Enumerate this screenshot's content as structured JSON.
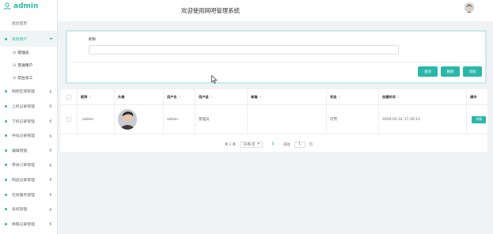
{
  "brand": {
    "name": "admin"
  },
  "header": {
    "title": "欢迎使用网吧管理系统"
  },
  "sidebar": {
    "home": "后台首页",
    "items": [
      {
        "label": "系统用户",
        "active": true,
        "children": [
          "管理员",
          "普通用户",
          "前台员工"
        ]
      },
      {
        "label": "网吧区域管理"
      },
      {
        "label": "上机记录管理"
      },
      {
        "label": "下机记录管理"
      },
      {
        "label": "呼叫记录管理"
      },
      {
        "label": "编辑管理"
      },
      {
        "label": "零食订单管理"
      },
      {
        "label": "网品记录管理"
      },
      {
        "label": "在线服务管理"
      },
      {
        "label": "系统管理"
      },
      {
        "label": "换鞋记录管理"
      }
    ]
  },
  "search": {
    "label": "昵称",
    "value": "",
    "placeholder": "",
    "buttons": {
      "search": "查询",
      "delete": "删除",
      "add": "添加"
    }
  },
  "table": {
    "columns": [
      "",
      "昵称",
      "头像",
      "用户名",
      "用户组",
      "邮箱",
      "状态",
      "创建时间",
      "操作"
    ],
    "rows": [
      {
        "nickname": "admin",
        "username": "admin",
        "group": "管理员",
        "email": "",
        "status": "可用",
        "created": "2020-01-31 17:30:13",
        "action": "详情"
      }
    ]
  },
  "pagination": {
    "total": "共 1 条",
    "page_size": "10条/页",
    "prev": "‹",
    "page": "1",
    "next": "›",
    "goto": "前往",
    "goto_value": "1",
    "page_unit": "页"
  },
  "colors": {
    "accent": "#2ab7a9"
  }
}
